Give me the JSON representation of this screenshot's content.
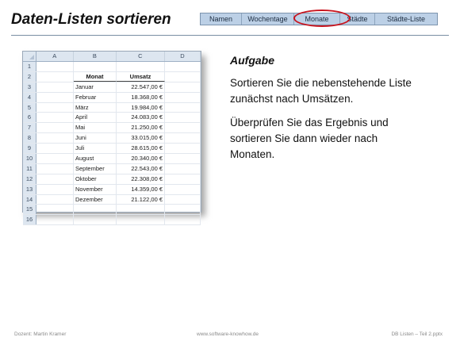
{
  "slide": {
    "title": "Daten-Listen sortieren"
  },
  "nav_tabs": [
    {
      "label": "Namen"
    },
    {
      "label": "Wochentage"
    },
    {
      "label": "Monate",
      "highlighted": true
    },
    {
      "label": "Städte"
    },
    {
      "label": "Städte-Liste"
    }
  ],
  "colors": {
    "tab_bar": "#bcd0e6",
    "highlight_ring": "#c8141e",
    "sheet_header": "#dde6f0"
  },
  "spreadsheet": {
    "column_letters": [
      "A",
      "B",
      "C",
      "D"
    ],
    "row_numbers": [
      "1",
      "2",
      "3",
      "4",
      "5",
      "6",
      "7",
      "8",
      "9",
      "10",
      "11",
      "12",
      "13",
      "14",
      "15",
      "16"
    ],
    "header": {
      "month": "Monat",
      "sales": "Umsatz"
    },
    "rows": [
      {
        "month": "Januar",
        "sales": "22.547,00 €"
      },
      {
        "month": "Februar",
        "sales": "18.368,00 €"
      },
      {
        "month": "März",
        "sales": "19.984,00 €"
      },
      {
        "month": "April",
        "sales": "24.083,00 €"
      },
      {
        "month": "Mai",
        "sales": "21.250,00 €"
      },
      {
        "month": "Juni",
        "sales": "33.015,00 €"
      },
      {
        "month": "Juli",
        "sales": "28.615,00 €"
      },
      {
        "month": "August",
        "sales": "20.340,00 €"
      },
      {
        "month": "September",
        "sales": "22.543,00 €"
      },
      {
        "month": "Oktober",
        "sales": "22.308,00 €"
      },
      {
        "month": "November",
        "sales": "14.359,00 €"
      },
      {
        "month": "Dezember",
        "sales": "21.122,00 €"
      }
    ]
  },
  "task": {
    "heading": "Aufgabe",
    "paragraph_1": "Sortieren Sie die nebenstehende Liste zunächst nach Umsätzen.",
    "paragraph_2": "Überprüfen Sie das Ergebnis und sortieren Sie dann wieder nach Monaten."
  },
  "footer": {
    "left": "Dozent: Martin Kramer",
    "center": "www.software-knowhow.de",
    "right": "DB Listen – Teil 2.pptx"
  }
}
